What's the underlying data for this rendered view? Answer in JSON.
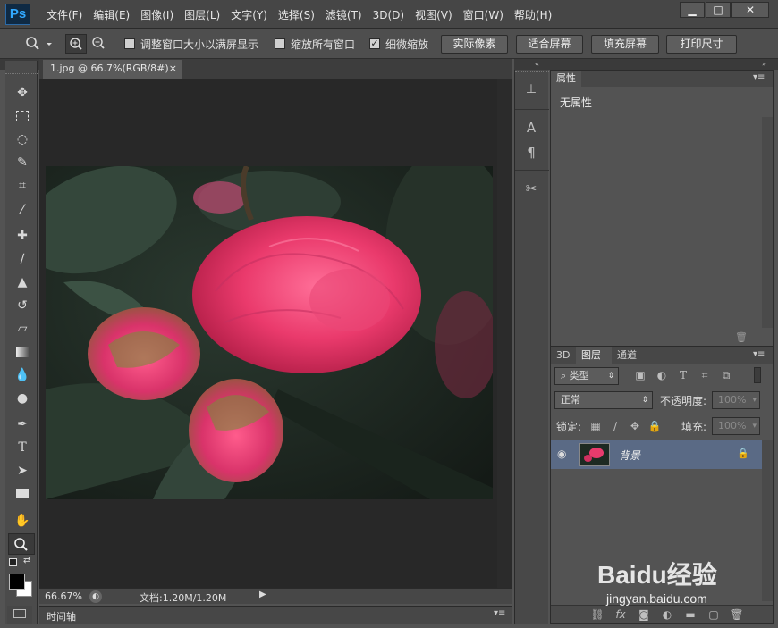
{
  "app": {
    "logo": "Ps"
  },
  "menu": [
    "文件(F)",
    "编辑(E)",
    "图像(I)",
    "图层(L)",
    "文字(Y)",
    "选择(S)",
    "滤镜(T)",
    "3D(D)",
    "视图(V)",
    "窗口(W)",
    "帮助(H)"
  ],
  "window_controls": {
    "minimize": "▁",
    "maximize": "□",
    "close": "✕"
  },
  "options": {
    "resize_windows_label": "调整窗口大小以满屏显示",
    "resize_windows_checked": false,
    "zoom_all_label": "缩放所有窗口",
    "zoom_all_checked": false,
    "scrubby_zoom_label": "细微缩放",
    "scrubby_zoom_checked": true,
    "btn_actual_pixels": "实际像素",
    "btn_fit_screen": "适合屏幕",
    "btn_fill_screen": "填充屏幕",
    "btn_print_size": "打印尺寸"
  },
  "document": {
    "tab_title": "1.jpg @ 66.7%(RGB/8#)",
    "tab_close": "×",
    "zoom": "66.67%",
    "doc_size": "文档:1.20M/1.20M"
  },
  "timeline_label": "时间轴",
  "properties": {
    "tab": "属性",
    "empty_text": "无属性"
  },
  "layers_panel": {
    "tabs": [
      "3D",
      "图层",
      "通道"
    ],
    "active_tab": "图层",
    "filter_kind": "类型",
    "blend_mode": "正常",
    "opacity_label": "不透明度:",
    "opacity_value": "100%",
    "lock_label": "锁定:",
    "fill_label": "填充:",
    "fill_value": "100%",
    "layers": [
      {
        "name": "背景",
        "visible": true,
        "locked": true
      }
    ]
  },
  "colors": {
    "accent_blue": "#31a8ff",
    "selected_layer": "#5a6a85"
  },
  "watermark": {
    "brand": "Baidu经验",
    "url": "jingyan.baidu.com"
  }
}
